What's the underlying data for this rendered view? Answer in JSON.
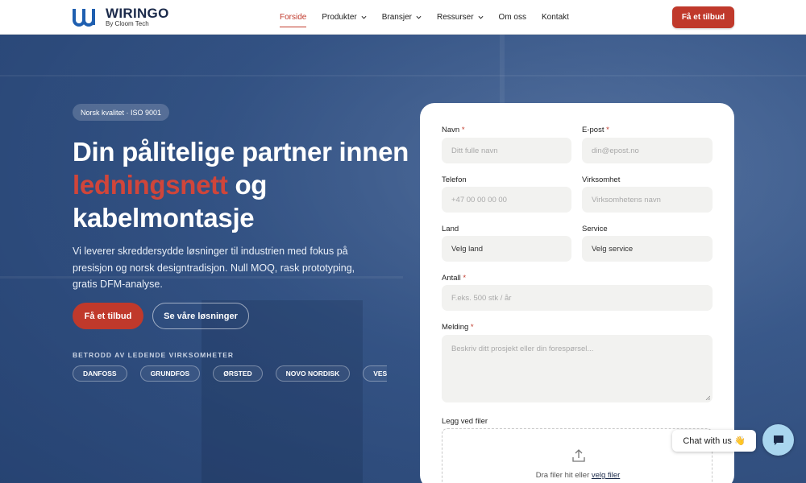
{
  "brand": {
    "name": "WIRINGO",
    "subtitle": "By Cloom Tech"
  },
  "nav": {
    "items": [
      {
        "label": "Forside",
        "active": true,
        "dropdown": false
      },
      {
        "label": "Produkter",
        "active": false,
        "dropdown": true
      },
      {
        "label": "Bransjer",
        "active": false,
        "dropdown": true
      },
      {
        "label": "Ressurser",
        "active": false,
        "dropdown": true
      },
      {
        "label": "Om oss",
        "active": false,
        "dropdown": false
      },
      {
        "label": "Kontakt",
        "active": false,
        "dropdown": false
      }
    ],
    "cta": "Få et tilbud"
  },
  "hero": {
    "badge": "Norsk kvalitet · ISO 9001",
    "headline_part1": "Din pålitelige partner innen ",
    "headline_accent": "ledningsnett",
    "headline_part2": " og kabelmontasje",
    "lead": "Vi leverer skreddersydde løsninger til industrien med fokus på presisjon og norsk designtradisjon. Null MOQ, rask prototyping, gratis DFM-analyse.",
    "primary_button": "Få et tilbud",
    "secondary_button": "Se våre løsninger",
    "trusted_label": "BETRODD AV LEDENDE VIRKSOMHETER",
    "clients": [
      "DANFOSS",
      "GRUNDFOS",
      "ØRSTED",
      "NOVO NORDISK",
      "VESTAS"
    ]
  },
  "form": {
    "required_mark": "*",
    "name": {
      "label": "Navn",
      "placeholder": "Ditt fulle navn"
    },
    "email": {
      "label": "E-post",
      "placeholder": "din@epost.no"
    },
    "phone": {
      "label": "Telefon",
      "placeholder": "+47 00 00 00 00"
    },
    "company": {
      "label": "Virksomhet",
      "placeholder": "Virksomhetens navn"
    },
    "country": {
      "label": "Land",
      "value": "Velg land"
    },
    "service": {
      "label": "Service",
      "value": "Velg service"
    },
    "quantity": {
      "label": "Antall",
      "placeholder": "F.eks. 500 stk / år"
    },
    "message": {
      "label": "Melding",
      "placeholder": "Beskriv ditt prosjekt eller din forespørsel..."
    },
    "files": {
      "label": "Legg ved filer",
      "text": "Dra filer hit eller ",
      "link": "velg filer"
    }
  },
  "chat": {
    "label": "Chat with us 👋"
  },
  "colors": {
    "accent": "#c0392b",
    "navy": "#1b2a4a",
    "chat": "#a9d6ef"
  }
}
